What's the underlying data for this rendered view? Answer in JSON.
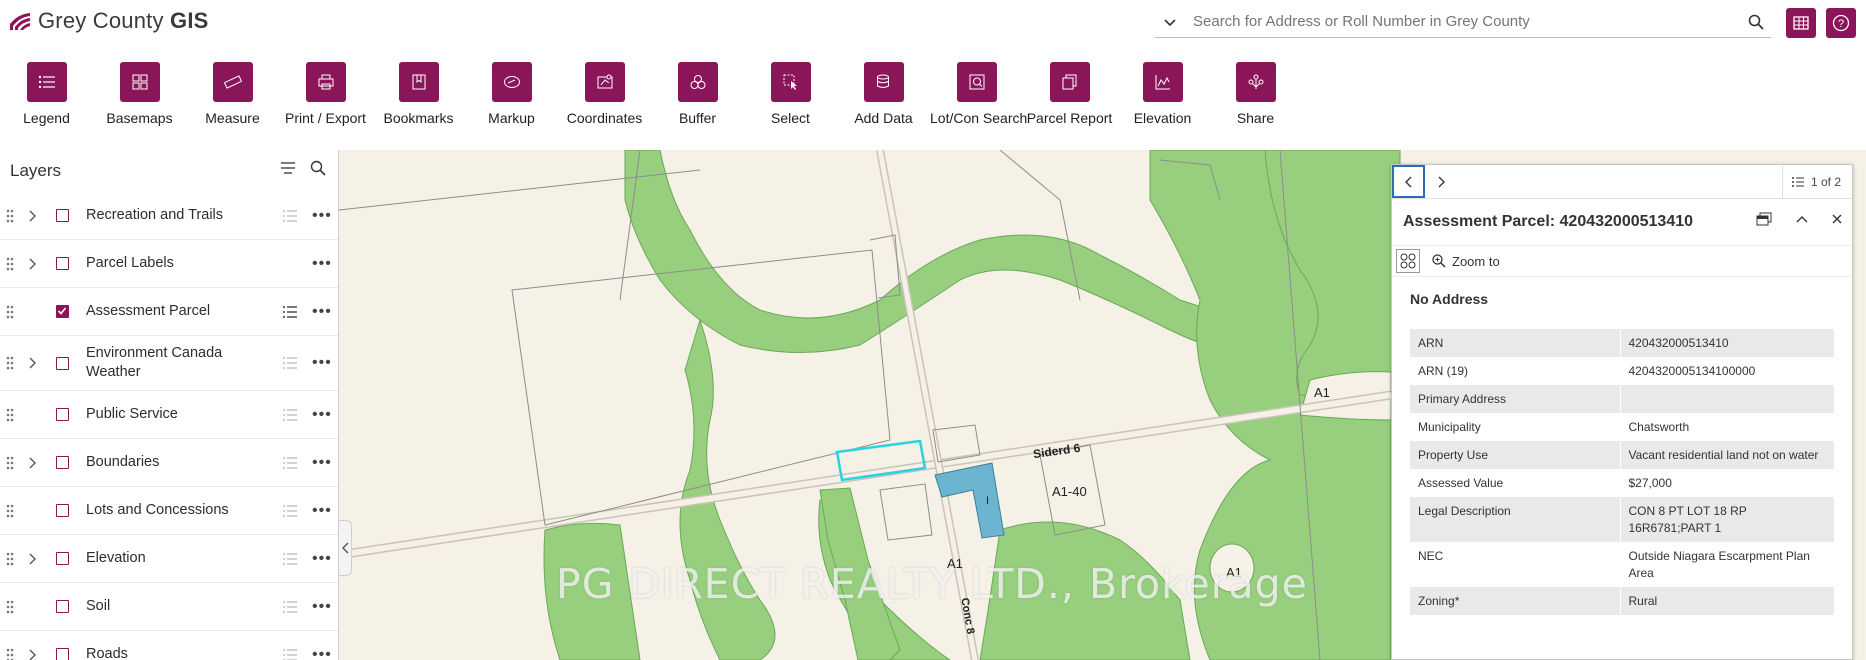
{
  "app": {
    "title_light": "Grey County ",
    "title_bold": "GIS",
    "brand_color": "#8b1559"
  },
  "search": {
    "placeholder": "Search for Address or Roll Number in Grey County"
  },
  "header_buttons": [
    {
      "icon": "table-icon"
    },
    {
      "icon": "help-icon"
    }
  ],
  "toolbar": [
    {
      "label": "Legend",
      "icon": "list-icon"
    },
    {
      "label": "Basemaps",
      "icon": "basemaps-icon"
    },
    {
      "label": "Measure",
      "icon": "ruler-icon"
    },
    {
      "label": "Print / Export",
      "icon": "print-icon"
    },
    {
      "label": "Bookmarks",
      "icon": "bookmark-icon"
    },
    {
      "label": "Markup",
      "icon": "markup-icon"
    },
    {
      "label": "Coordinates",
      "icon": "coordinates-icon"
    },
    {
      "label": "Buffer",
      "icon": "buffer-icon"
    },
    {
      "label": "Select",
      "icon": "select-icon"
    },
    {
      "label": "Add Data",
      "icon": "add-data-icon"
    },
    {
      "label": "Lot/Con Search",
      "icon": "lotcon-search-icon"
    },
    {
      "label": "Parcel Report",
      "icon": "parcel-report-icon"
    },
    {
      "label": "Elevation",
      "icon": "elevation-icon"
    },
    {
      "label": "Share",
      "icon": "share-icon"
    }
  ],
  "layers_panel": {
    "title": "Layers",
    "items": [
      {
        "label": "Recreation and Trails",
        "expandable": true,
        "checked": false
      },
      {
        "label": "Parcel Labels",
        "expandable": true,
        "checked": false
      },
      {
        "label": "Assessment Parcel",
        "expandable": false,
        "checked": true
      },
      {
        "label": "Environment Canada Weather",
        "expandable": true,
        "checked": false
      },
      {
        "label": "Public Service",
        "expandable": false,
        "checked": false
      },
      {
        "label": "Boundaries",
        "expandable": true,
        "checked": false
      },
      {
        "label": "Lots and Concessions",
        "expandable": false,
        "checked": false
      },
      {
        "label": "Elevation",
        "expandable": true,
        "checked": false
      },
      {
        "label": "Soil",
        "expandable": false,
        "checked": false
      },
      {
        "label": "Roads",
        "expandable": true,
        "checked": false
      }
    ]
  },
  "map": {
    "labels": {
      "a1_right": "A1",
      "sideroad": "Siderd 6",
      "a1_40": "A1-40",
      "i_zone": "I",
      "a1_center": "A1",
      "a1_bottom": "A1",
      "concession": "Conc 8"
    },
    "watermark": "PG DIRECT REALTY LTD., Brokerage",
    "colors": {
      "land": "#f5f1e6",
      "wooded": "#97cf7f",
      "selected_parcel": "#6bb5d0",
      "highlight": "#27d3e0"
    }
  },
  "popup": {
    "pager": "1 of 2",
    "title": "Assessment Parcel: 420432000513410",
    "zoom_to": "Zoom to",
    "address": "No Address",
    "attributes": [
      {
        "key": "ARN",
        "value": "420432000513410"
      },
      {
        "key": "ARN (19)",
        "value": "4204320005134100000"
      },
      {
        "key": "Primary Address",
        "value": ""
      },
      {
        "key": "Municipality",
        "value": "Chatsworth"
      },
      {
        "key": "Property Use",
        "value": "Vacant residential land not on water"
      },
      {
        "key": "Assessed Value",
        "value": "$27,000"
      },
      {
        "key": "Legal Description",
        "value": "CON 8 PT LOT 18 RP 16R6781;PART 1"
      },
      {
        "key": "NEC",
        "value": "Outside Niagara Escarpment Plan Area"
      },
      {
        "key": "Zoning*",
        "value": "Rural"
      }
    ]
  }
}
